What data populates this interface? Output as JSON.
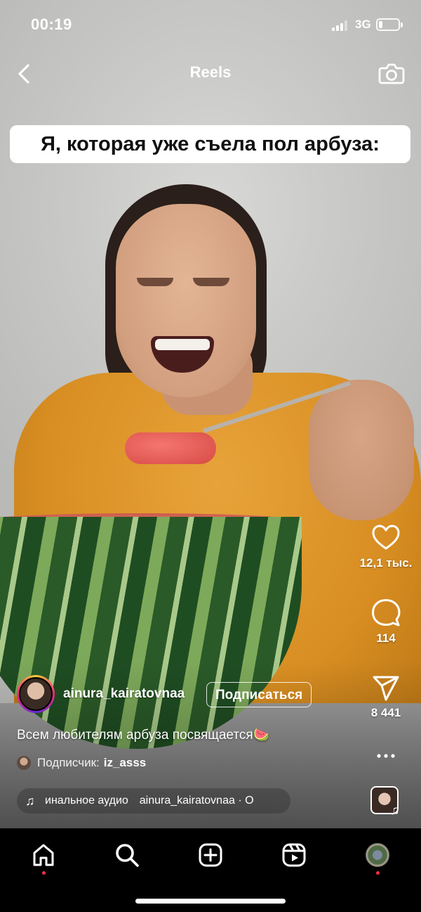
{
  "status_bar": {
    "time": "00:19",
    "network": "3G",
    "battery_level": 0.2
  },
  "header": {
    "title": "Reels",
    "back_icon": "chevron-left-icon",
    "camera_icon": "camera-icon"
  },
  "video": {
    "overlay_caption": "Я, которая уже съела пол арбуза:"
  },
  "actions": {
    "likes": "12,1 тыс.",
    "comments": "114",
    "shares": "8 441"
  },
  "author": {
    "username": "ainura_kairatovnaa",
    "follow_label": "Подписаться"
  },
  "description": "Всем любителям арбуза посвящается🍉",
  "follower": {
    "label": "Подписчик:",
    "name": "iz_asss"
  },
  "audio": {
    "text": "инальное аудио",
    "artist": "ainura_kairatovnaa · О"
  },
  "tabbar": {
    "items": [
      "home-icon",
      "search-icon",
      "new-post-icon",
      "reels-icon",
      "profile-avatar"
    ]
  },
  "colors": {
    "accent_dot": "#ff3040",
    "tabbar_bg": "#000000"
  }
}
